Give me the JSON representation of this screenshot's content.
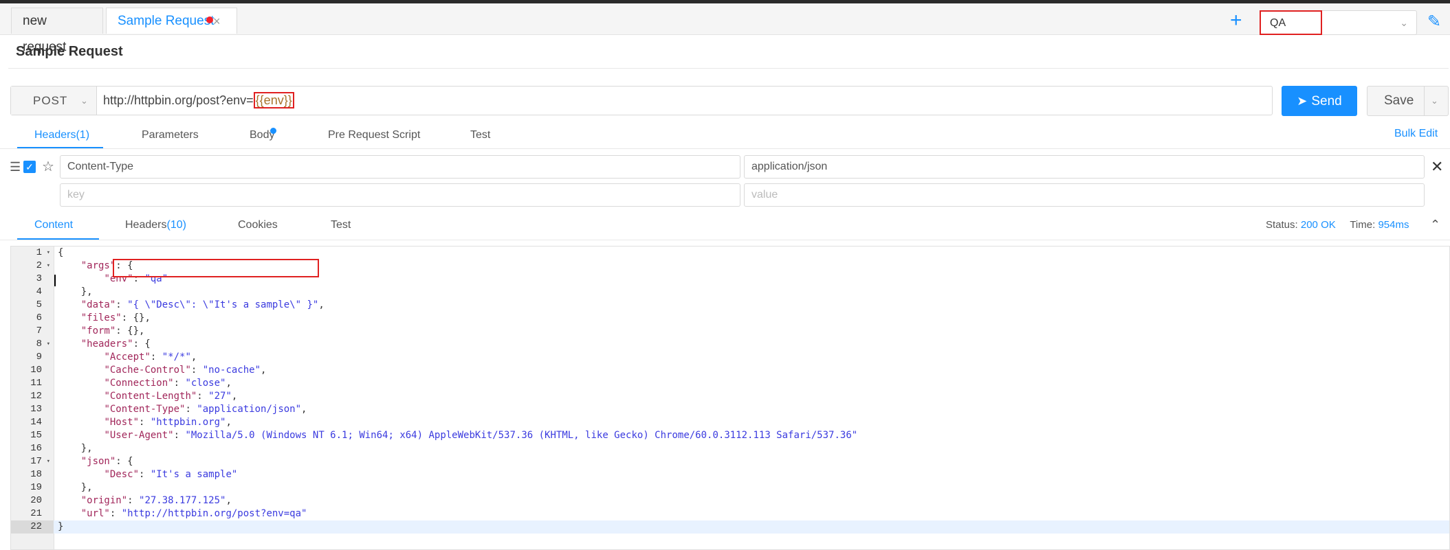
{
  "tabs": [
    {
      "label": "new request"
    },
    {
      "label": "Sample Request",
      "close_icon": "×"
    }
  ],
  "env": {
    "selected": "QA"
  },
  "request": {
    "title": "Sample Request",
    "method": "POST",
    "url_prefix": "http://httpbin.org/post?env=",
    "url_var": "{{env}}",
    "send_label": "Send",
    "save_label": "Save"
  },
  "request_tabs": [
    "Headers(1)",
    "Parameters",
    "Body",
    "Pre Request Script",
    "Test"
  ],
  "bulk_edit": "Bulk Edit",
  "headers": {
    "row1": {
      "key": "Content-Type",
      "value": "application/json"
    },
    "placeholders": {
      "key": "key",
      "value": "value"
    }
  },
  "response_tabs": {
    "content": "Content",
    "headers_label": "Headers",
    "headers_count": "(10)",
    "cookies": "Cookies",
    "test": "Test"
  },
  "status": {
    "status_label": "Status:",
    "status_value": "200 OK",
    "time_label": "Time:",
    "time_value": "954ms"
  },
  "code_lines": [
    {
      "n": "1",
      "fold": true,
      "tokens": [
        [
          "p",
          "{"
        ]
      ]
    },
    {
      "n": "2",
      "fold": true,
      "tokens": [
        [
          "p",
          "    "
        ],
        [
          "k",
          "\"args\""
        ],
        [
          "p",
          ": {"
        ]
      ]
    },
    {
      "n": "3",
      "tokens": [
        [
          "p",
          "        "
        ],
        [
          "k",
          "\"env\""
        ],
        [
          "p",
          ": "
        ],
        [
          "s",
          "\"qa\""
        ]
      ]
    },
    {
      "n": "4",
      "tokens": [
        [
          "p",
          "    },"
        ]
      ]
    },
    {
      "n": "5",
      "tokens": [
        [
          "p",
          "    "
        ],
        [
          "k",
          "\"data\""
        ],
        [
          "p",
          ": "
        ],
        [
          "s",
          "\"{ \\\"Desc\\\": \\\"It's a sample\\\" }\""
        ],
        [
          "p",
          ","
        ]
      ]
    },
    {
      "n": "6",
      "tokens": [
        [
          "p",
          "    "
        ],
        [
          "k",
          "\"files\""
        ],
        [
          "p",
          ": {},"
        ]
      ]
    },
    {
      "n": "7",
      "tokens": [
        [
          "p",
          "    "
        ],
        [
          "k",
          "\"form\""
        ],
        [
          "p",
          ": {},"
        ]
      ]
    },
    {
      "n": "8",
      "fold": true,
      "tokens": [
        [
          "p",
          "    "
        ],
        [
          "k",
          "\"headers\""
        ],
        [
          "p",
          ": {"
        ]
      ]
    },
    {
      "n": "9",
      "tokens": [
        [
          "p",
          "        "
        ],
        [
          "k",
          "\"Accept\""
        ],
        [
          "p",
          ": "
        ],
        [
          "s",
          "\"*/*\""
        ],
        [
          "p",
          ","
        ]
      ]
    },
    {
      "n": "10",
      "tokens": [
        [
          "p",
          "        "
        ],
        [
          "k",
          "\"Cache-Control\""
        ],
        [
          "p",
          ": "
        ],
        [
          "s",
          "\"no-cache\""
        ],
        [
          "p",
          ","
        ]
      ]
    },
    {
      "n": "11",
      "tokens": [
        [
          "p",
          "        "
        ],
        [
          "k",
          "\"Connection\""
        ],
        [
          "p",
          ": "
        ],
        [
          "s",
          "\"close\""
        ],
        [
          "p",
          ","
        ]
      ]
    },
    {
      "n": "12",
      "tokens": [
        [
          "p",
          "        "
        ],
        [
          "k",
          "\"Content-Length\""
        ],
        [
          "p",
          ": "
        ],
        [
          "s",
          "\"27\""
        ],
        [
          "p",
          ","
        ]
      ]
    },
    {
      "n": "13",
      "tokens": [
        [
          "p",
          "        "
        ],
        [
          "k",
          "\"Content-Type\""
        ],
        [
          "p",
          ": "
        ],
        [
          "s",
          "\"application/json\""
        ],
        [
          "p",
          ","
        ]
      ]
    },
    {
      "n": "14",
      "tokens": [
        [
          "p",
          "        "
        ],
        [
          "k",
          "\"Host\""
        ],
        [
          "p",
          ": "
        ],
        [
          "s",
          "\"httpbin.org\""
        ],
        [
          "p",
          ","
        ]
      ]
    },
    {
      "n": "15",
      "tokens": [
        [
          "p",
          "        "
        ],
        [
          "k",
          "\"User-Agent\""
        ],
        [
          "p",
          ": "
        ],
        [
          "s",
          "\"Mozilla/5.0 (Windows NT 6.1; Win64; x64) AppleWebKit/537.36 (KHTML, like Gecko) Chrome/60.0.3112.113 Safari/537.36\""
        ]
      ]
    },
    {
      "n": "16",
      "tokens": [
        [
          "p",
          "    },"
        ]
      ]
    },
    {
      "n": "17",
      "fold": true,
      "tokens": [
        [
          "p",
          "    "
        ],
        [
          "k",
          "\"json\""
        ],
        [
          "p",
          ": {"
        ]
      ]
    },
    {
      "n": "18",
      "tokens": [
        [
          "p",
          "        "
        ],
        [
          "k",
          "\"Desc\""
        ],
        [
          "p",
          ": "
        ],
        [
          "s",
          "\"It's a sample\""
        ]
      ]
    },
    {
      "n": "19",
      "tokens": [
        [
          "p",
          "    },"
        ]
      ]
    },
    {
      "n": "20",
      "tokens": [
        [
          "p",
          "    "
        ],
        [
          "k",
          "\"origin\""
        ],
        [
          "p",
          ": "
        ],
        [
          "s",
          "\"27.38.177.125\""
        ],
        [
          "p",
          ","
        ]
      ]
    },
    {
      "n": "21",
      "tokens": [
        [
          "p",
          "    "
        ],
        [
          "k",
          "\"url\""
        ],
        [
          "p",
          ": "
        ],
        [
          "s",
          "\"http://httpbin.org/post?env=qa\""
        ]
      ]
    },
    {
      "n": "22",
      "active": true,
      "tokens": [
        [
          "p",
          "}"
        ]
      ]
    }
  ],
  "colors": {
    "accent": "#1890ff",
    "highlight_box": "#e02020",
    "json_key": "#a1265a",
    "json_string": "#3a3adf"
  },
  "icons": [
    "plus-icon",
    "chevron-down-icon",
    "pencil-icon",
    "rocket-icon",
    "close-icon",
    "drag-handle-icon",
    "star-icon",
    "checkbox-icon",
    "chevron-up-icon"
  ]
}
